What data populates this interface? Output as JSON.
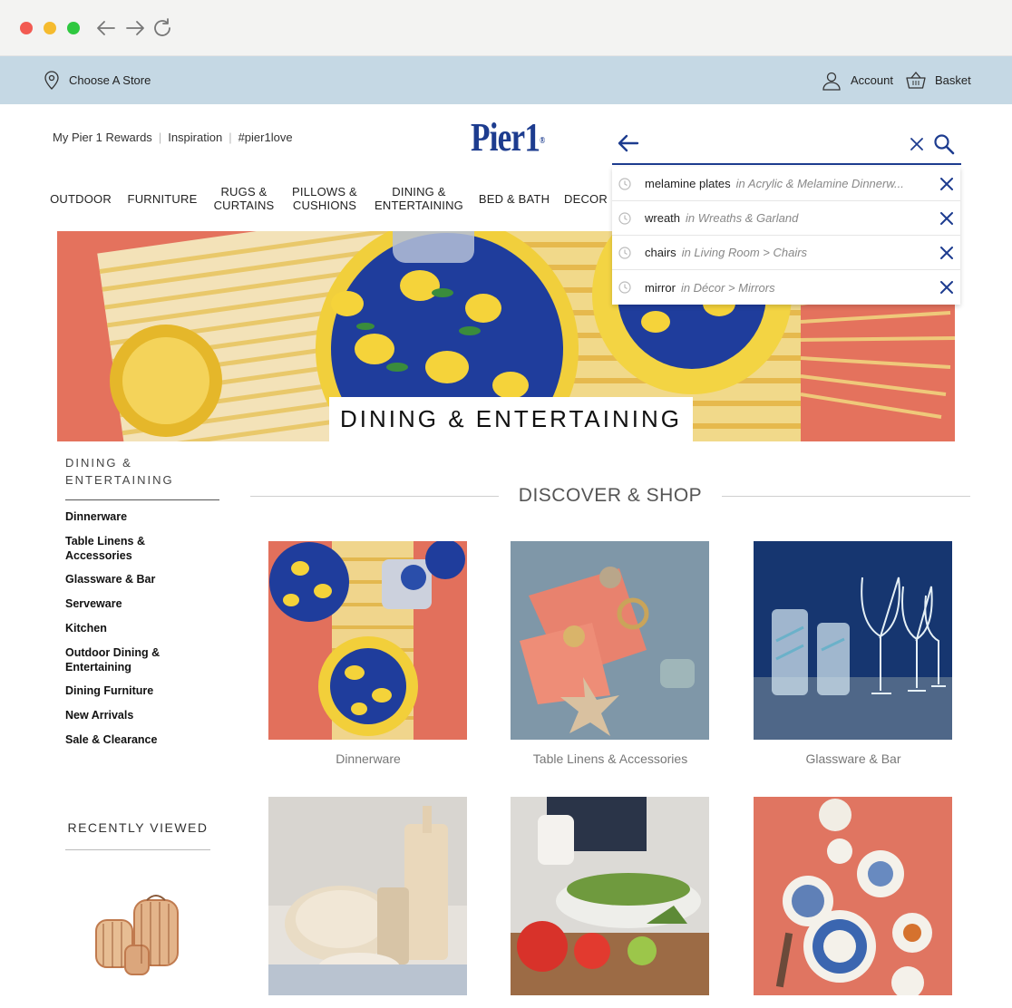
{
  "browser": {
    "buttons": [
      "back-arrow",
      "forward-arrow",
      "reload"
    ]
  },
  "utility_bar": {
    "store_label": "Choose A Store",
    "account_label": "Account",
    "basket_label": "Basket",
    "background": "#c5d8e4"
  },
  "header": {
    "links": [
      "My Pier 1 Rewards",
      "Inspiration",
      "#pier1love"
    ],
    "logo_text": "Pier1",
    "logo_mark": "®",
    "brand_color": "#1d3c8f"
  },
  "main_nav": [
    {
      "label": "OUTDOOR"
    },
    {
      "label": "FURNITURE"
    },
    {
      "label": "RUGS &",
      "label2": "CURTAINS"
    },
    {
      "label": "PILLOWS &",
      "label2": "CUSHIONS"
    },
    {
      "label": "DINING &",
      "label2": "ENTERTAINING"
    },
    {
      "label": "BED & BATH"
    },
    {
      "label": "DECOR"
    }
  ],
  "search": {
    "value": "",
    "placeholder": "",
    "suggestions": [
      {
        "term": "melamine plates",
        "context": "in Acrylic & Melamine Dinnerw..."
      },
      {
        "term": "wreath",
        "context": "in Wreaths & Garland"
      },
      {
        "term": "chairs",
        "context": "in Living Room > Chairs"
      },
      {
        "term": "mirror",
        "context": "in Décor > Mirrors"
      }
    ]
  },
  "hero": {
    "title": "DINING & ENTERTAINING"
  },
  "sidebar": {
    "heading_line1": "DINING &",
    "heading_line2": "ENTERTAINING",
    "items": [
      {
        "line1": "Dinnerware"
      },
      {
        "line1": "Table Linens &",
        "line2": "Accessories"
      },
      {
        "line1": "Glassware & Bar"
      },
      {
        "line1": "Serveware"
      },
      {
        "line1": "Kitchen"
      },
      {
        "line1": "Outdoor Dining &",
        "line2": "Entertaining"
      },
      {
        "line1": "Dining Furniture"
      },
      {
        "line1": "New Arrivals"
      },
      {
        "line1": "Sale & Clearance"
      }
    ],
    "recently_viewed_title": "RECENTLY VIEWED"
  },
  "discover": {
    "title": "DISCOVER & SHOP",
    "tiles": [
      {
        "label": "Dinnerware"
      },
      {
        "label": "Table Linens & Accessories"
      },
      {
        "label": "Glassware & Bar"
      },
      {
        "label": ""
      },
      {
        "label": ""
      },
      {
        "label": ""
      }
    ]
  }
}
